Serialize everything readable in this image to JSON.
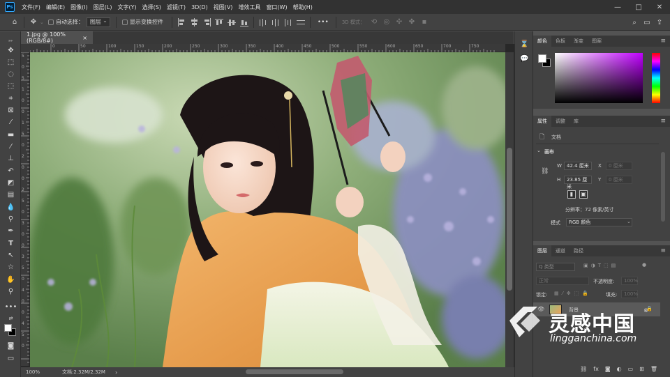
{
  "app": {
    "logo_text": "Ps"
  },
  "menu": [
    "文件(F)",
    "编辑(E)",
    "图像(I)",
    "图层(L)",
    "文字(Y)",
    "选择(S)",
    "滤镜(T)",
    "3D(D)",
    "视图(V)",
    "增效工具",
    "窗口(W)",
    "帮助(H)"
  ],
  "window_controls": {
    "minimize": "—",
    "maximize": "□",
    "close": "✕"
  },
  "options": {
    "auto_select_label": "自动选择：",
    "auto_select_value": "图层",
    "show_transform_label": "显示变换控件",
    "more": "•••",
    "mode_3d_label": "3D 模式："
  },
  "document": {
    "tab_title": "1.jpg @ 100%(RGB/8#)",
    "tab_close": "×",
    "zoom": "100%",
    "doc_info": "文档:2.32M/2.32M",
    "status_arrow": "›"
  },
  "ruler": {
    "top_ticks": [
      "50",
      "0",
      "50",
      "100",
      "150",
      "200",
      "250",
      "300",
      "350",
      "400",
      "450",
      "500",
      "550",
      "600",
      "650",
      "700",
      "750"
    ],
    "left_ticks": [
      "5",
      "0",
      "5",
      "1",
      "0",
      "0",
      "1",
      "5",
      "0",
      "2",
      "0",
      "0",
      "2",
      "5",
      "0",
      "3",
      "0",
      "0",
      "3",
      "5",
      "0",
      "4",
      "0",
      "0",
      "4",
      "5",
      "0"
    ]
  },
  "color_panel": {
    "tabs": [
      "颜色",
      "色板",
      "渐变",
      "图案"
    ],
    "active": 0,
    "foreground": "#ffffff",
    "background": "#000000"
  },
  "properties_panel": {
    "tabs": [
      "属性",
      "调整",
      "库"
    ],
    "active": 0,
    "doc_label": "文档",
    "canvas_section": "画布",
    "w_label": "W",
    "w_value": "42.4 厘米",
    "h_label": "H",
    "h_value": "23.85 厘米",
    "x_label": "X",
    "x_value": "0 厘米",
    "y_label": "Y",
    "y_value": "0 厘米",
    "resolution": "分辨率：72 像素/英寸",
    "mode_label": "模式",
    "mode_value": "RGB 颜色"
  },
  "layers_panel": {
    "tabs": [
      "图层",
      "通道",
      "路径"
    ],
    "active": 0,
    "filter_value": "Q 类型",
    "blend_mode": "正常",
    "opacity_label": "不透明度:",
    "opacity_value": "100%",
    "lock_label": "锁定:",
    "fill_label": "填充:",
    "fill_value": "100%",
    "layers": [
      {
        "name": "背景",
        "visible": true,
        "locked": true
      }
    ]
  },
  "watermark": {
    "cn": "灵感中国",
    "en": "lingganchina.com",
    "trademark": "®"
  }
}
